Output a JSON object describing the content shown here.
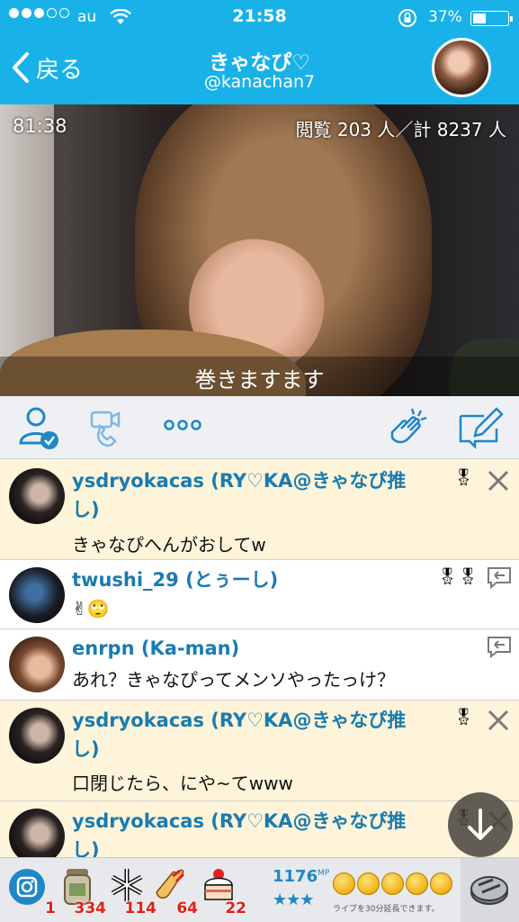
{
  "status_bar": {
    "carrier": "au",
    "time": "21:58",
    "battery": "37%",
    "battery_level": 0.37
  },
  "nav": {
    "back_label": "戻る",
    "title": "きゃなぴ♡",
    "username": "@kanachan7",
    "avatar_icon": "broadcaster-avatar"
  },
  "video": {
    "elapsed": "81:38",
    "viewers": "閲覧 203 人／計 8237 人",
    "caption": "巻きますます"
  },
  "actions": {
    "follow_icon": "user-check-icon",
    "call_icon": "video-call-icon",
    "more_icon": "more-icon",
    "clap_icon": "clap-icon",
    "compose_icon": "compose-icon"
  },
  "comments": [
    {
      "name_line1": "ysdryokacas (RY♡KA@きゃなぴ推",
      "name_line2": "し)",
      "text": "きゃなぴへんがおしてw",
      "medals": "🎖",
      "action": "×",
      "highlight": true
    },
    {
      "name_line1": "twushi_29 (とぅーし)",
      "name_line2": "",
      "text": "✌🙄",
      "medals": "🎖🎖",
      "action": "reply",
      "highlight": false
    },
    {
      "name_line1": "enrpn (Ka-man)",
      "name_line2": "",
      "text": "あれ？きゃなぴってメンソやったっけ？",
      "medals": "",
      "action": "reply",
      "highlight": false
    },
    {
      "name_line1": "ysdryokacas (RY♡KA@きゃなぴ推",
      "name_line2": "し)",
      "text": "口閉じたら、にや~てwww",
      "medals": "🎖",
      "action": "×",
      "highlight": true
    },
    {
      "name_line1": "ysdryokacas (RY♡KA@きゃなぴ推",
      "name_line2": "し)",
      "text": "",
      "medals": "🎖",
      "action": "×",
      "highlight": true
    }
  ],
  "bottom_bar": {
    "gifts": [
      {
        "icon": "instagram-icon",
        "count": "1"
      },
      {
        "icon": "jar-icon",
        "count": "334"
      },
      {
        "icon": "snowflake-icon",
        "count": "114"
      },
      {
        "icon": "clap-gift-icon",
        "count": "64"
      },
      {
        "icon": "cake-icon",
        "count": "22"
      }
    ],
    "mp_value": "1176",
    "mp_unit": "MP",
    "stars": "★★★",
    "extend_text": "ライブを30分延長できます。"
  },
  "colors": {
    "header": "#19b2e8",
    "accent": "#1f86c8",
    "highlight_row": "#fdf4da",
    "count_red": "#e0201b"
  }
}
